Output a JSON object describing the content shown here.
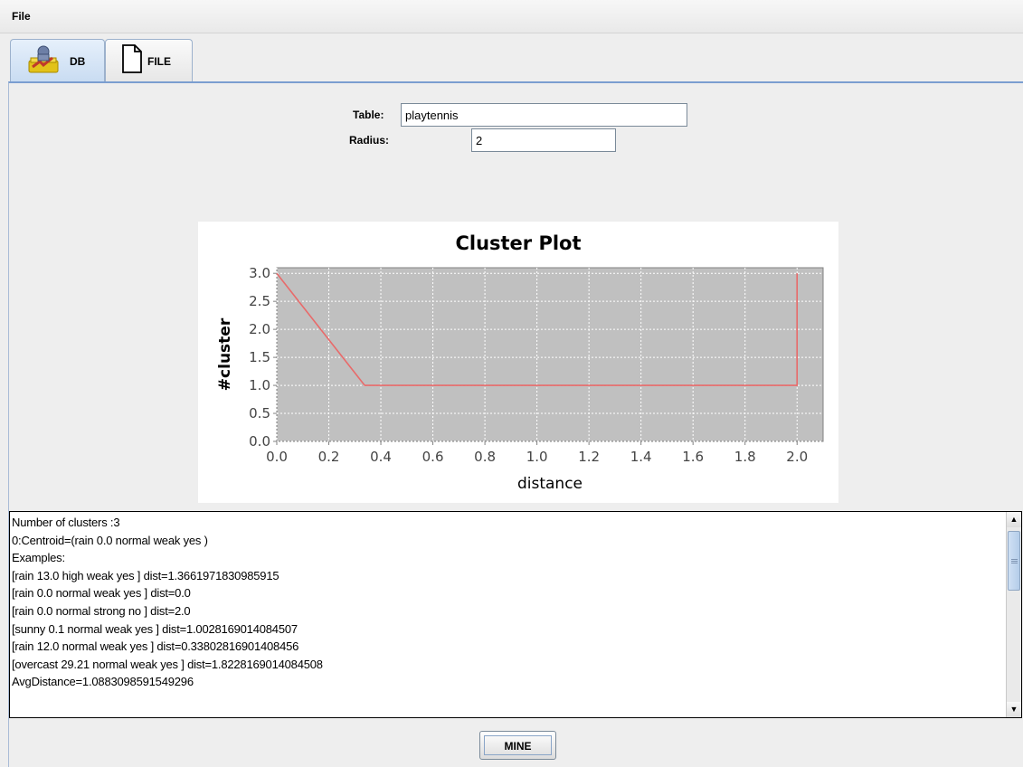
{
  "menu": {
    "file_label": "File"
  },
  "tabs": [
    {
      "label": "DB",
      "icon": "database-icon",
      "selected": true
    },
    {
      "label": "FILE",
      "icon": "file-icon",
      "selected": false
    }
  ],
  "form": {
    "table_label": "Table:",
    "table_value": "playtennis",
    "radius_label": "Radius:",
    "radius_value": "2"
  },
  "chart_data": {
    "type": "line",
    "title": "Cluster Plot",
    "xlabel": "distance",
    "ylabel": "#cluster",
    "x": [
      0.0,
      0.338,
      2.0,
      2.0
    ],
    "series": [
      {
        "values": [
          3,
          1,
          1,
          3
        ],
        "color": "#e86a6a"
      }
    ],
    "xlim": [
      0.0,
      2.1
    ],
    "ylim": [
      0.0,
      3.1
    ],
    "xticks": [
      "0.0",
      "0.2",
      "0.4",
      "0.6",
      "0.8",
      "1.0",
      "1.2",
      "1.4",
      "1.6",
      "1.8",
      "2.0"
    ],
    "yticks": [
      "0.0",
      "0.5",
      "1.0",
      "1.5",
      "2.0",
      "2.5",
      "3.0"
    ],
    "grid": true,
    "plot_background": "#c0c0c0"
  },
  "output": {
    "lines": [
      "Number of clusters :3",
      "0:Centroid=(rain 0.0 normal weak yes )",
      "Examples:",
      "[rain 13.0 high weak yes ] dist=1.3661971830985915",
      "[rain 0.0 normal weak yes ] dist=0.0",
      "[rain 0.0 normal strong no ] dist=2.0",
      "[sunny 0.1 normal weak yes ] dist=1.0028169014084507",
      "[rain 12.0 normal weak yes ] dist=0.33802816901408456",
      "[overcast 29.21 normal weak yes ] dist=1.8228169014084508",
      "AvgDistance=1.0883098591549296"
    ]
  },
  "mine_button": {
    "label": "MINE"
  },
  "colors": {
    "accent": "#7b9ed0",
    "series": "#e86a6a"
  }
}
